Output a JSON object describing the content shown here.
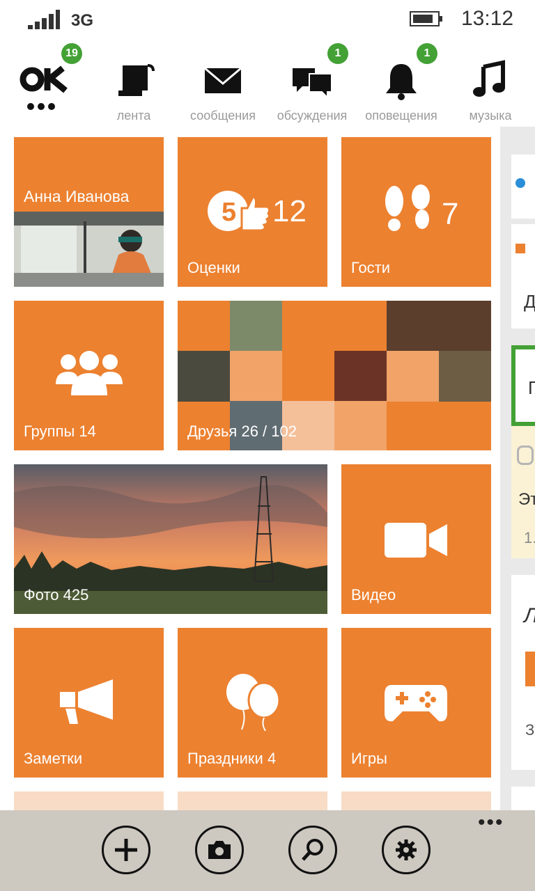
{
  "status_bar": {
    "network": "3G",
    "time": "13:12"
  },
  "nav": {
    "items": [
      {
        "label": "",
        "badge": "19"
      },
      {
        "label": "лента",
        "badge": ""
      },
      {
        "label": "сообщения",
        "badge": ""
      },
      {
        "label": "обсуждения",
        "badge": "1"
      },
      {
        "label": "оповещения",
        "badge": "1"
      },
      {
        "label": "музыка",
        "badge": ""
      }
    ]
  },
  "tiles": {
    "profile_name": "Анна Иванова",
    "ratings_count": "12",
    "ratings_label": "Оценки",
    "guests_count": "7",
    "guests_label": "Гости",
    "groups_label": "Группы 14",
    "friends_label": "Друзья 26 / 102",
    "photos_label": "Фото 425",
    "video_label": "Видео",
    "notes_label": "Заметки",
    "holidays_label": "Праздники 4",
    "games_label": "Игры"
  },
  "right_panel": {
    "snippets": [
      "Д",
      "П",
      "Эт",
      "1.",
      "Л",
      "З"
    ]
  },
  "app_bar": {
    "buttons": [
      "add",
      "camera",
      "search",
      "settings"
    ],
    "more": "•••"
  },
  "colors": {
    "accent": "#ec8130",
    "badge": "#43a135",
    "appbar": "#cdc8c0"
  }
}
